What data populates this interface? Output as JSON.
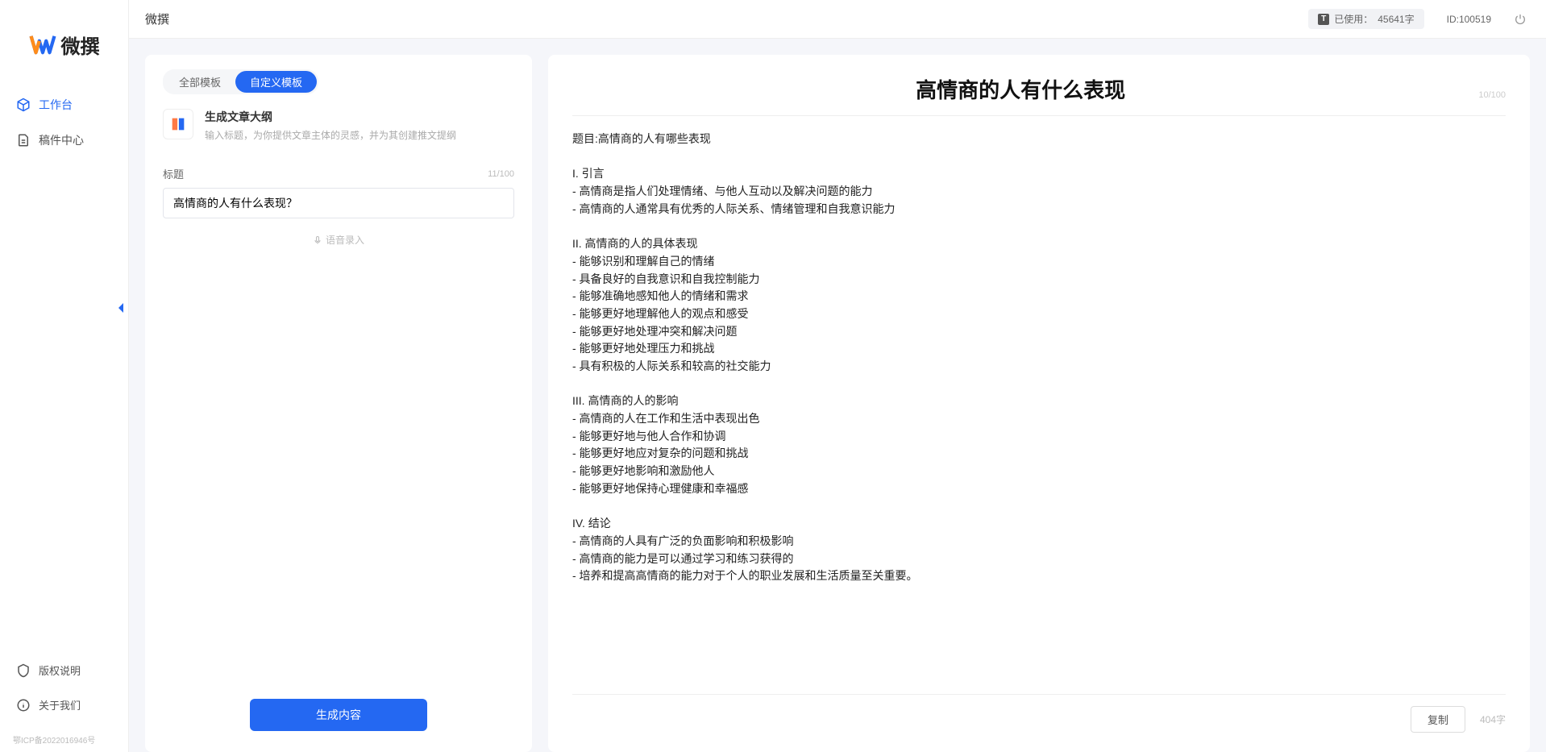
{
  "header": {
    "page_title": "微撰",
    "usage_label": "已使用：",
    "usage_value": "45641字",
    "user_id_label": "ID:",
    "user_id_value": "100519"
  },
  "sidebar": {
    "logo_text": "微撰",
    "nav": [
      {
        "label": "工作台",
        "active": true
      },
      {
        "label": "稿件中心",
        "active": false
      }
    ],
    "bottom_nav": [
      {
        "label": "版权说明"
      },
      {
        "label": "关于我们"
      }
    ],
    "icp": "鄂ICP备2022016946号"
  },
  "left": {
    "tabs": [
      {
        "label": "全部模板",
        "active": false
      },
      {
        "label": "自定义模板",
        "active": true
      }
    ],
    "template": {
      "title": "生成文章大纲",
      "desc": "输入标题，为你提供文章主体的灵感，并为其创建推文提纲"
    },
    "form_label": "标题",
    "char_count": "11/100",
    "title_value": "高情商的人有什么表现？",
    "voice_label": "语音录入",
    "generate_label": "生成内容"
  },
  "right": {
    "title": "高情商的人有什么表现",
    "title_count": "10/100",
    "body": "题目:高情商的人有哪些表现\n\nI. 引言\n- 高情商是指人们处理情绪、与他人互动以及解决问题的能力\n- 高情商的人通常具有优秀的人际关系、情绪管理和自我意识能力\n\nII. 高情商的人的具体表现\n- 能够识别和理解自己的情绪\n- 具备良好的自我意识和自我控制能力\n- 能够准确地感知他人的情绪和需求\n- 能够更好地理解他人的观点和感受\n- 能够更好地处理冲突和解决问题\n- 能够更好地处理压力和挑战\n- 具有积极的人际关系和较高的社交能力\n\nIII. 高情商的人的影响\n- 高情商的人在工作和生活中表现出色\n- 能够更好地与他人合作和协调\n- 能够更好地应对复杂的问题和挑战\n- 能够更好地影响和激励他人\n- 能够更好地保持心理健康和幸福感\n\nIV. 结论\n- 高情商的人具有广泛的负面影响和积极影响\n- 高情商的能力是可以通过学习和练习获得的\n- 培养和提高高情商的能力对于个人的职业发展和生活质量至关重要。",
    "copy_label": "复制",
    "word_count": "404字"
  }
}
